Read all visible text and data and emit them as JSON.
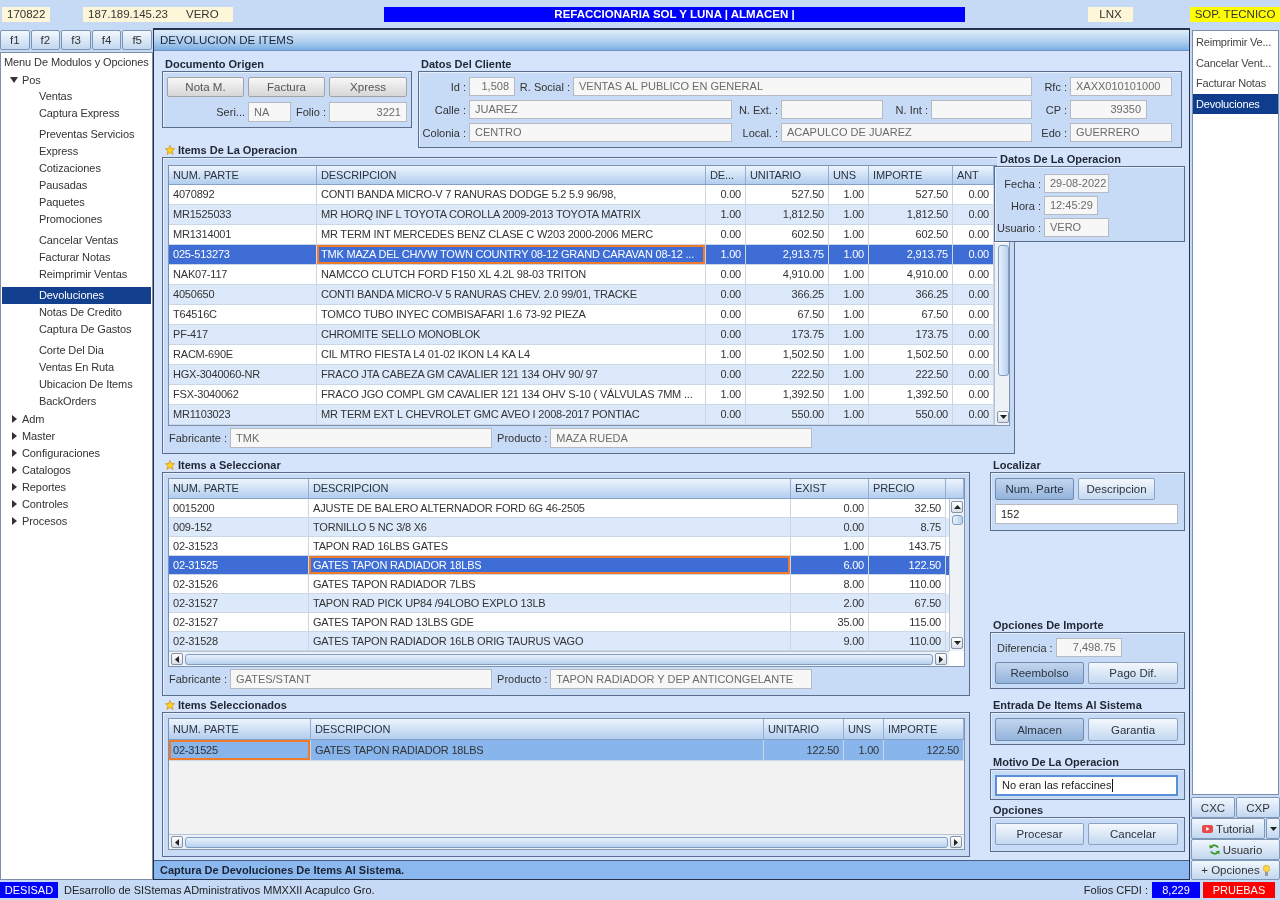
{
  "top_bar": {
    "code": "170822",
    "ip": "187.189.145.23",
    "user": "VERO",
    "title": "REFACCIONARIA SOL Y LUNA | ALMACEN |",
    "system": "LNX",
    "support": "SOP. TECNICO"
  },
  "function_keys": [
    "f1",
    "f2",
    "f3",
    "f4",
    "f5"
  ],
  "menu": {
    "title": "Menu De Modulos y Opciones",
    "items": [
      {
        "label": "Pos",
        "expanded": true,
        "groups": [
          {
            "children": [
              {
                "label": "Ventas",
                "selected": false
              },
              {
                "label": "Captura Express",
                "selected": false
              }
            ]
          },
          {
            "children": [
              {
                "label": "Preventas Servicios",
                "selected": false
              },
              {
                "label": "Express",
                "selected": false
              },
              {
                "label": "Cotizaciones",
                "selected": false
              },
              {
                "label": "Pausadas",
                "selected": false
              },
              {
                "label": "Paquetes",
                "selected": false
              },
              {
                "label": "Promociones",
                "selected": false
              }
            ]
          },
          {
            "children": [
              {
                "label": "Cancelar Ventas",
                "selected": false
              },
              {
                "label": "Facturar Notas",
                "selected": false
              },
              {
                "label": "Reimprimir Ventas",
                "selected": false
              }
            ]
          },
          {
            "children": [
              {
                "label": "Devoluciones",
                "selected": true
              },
              {
                "label": "Notas De Credito",
                "selected": false
              },
              {
                "label": "Captura De Gastos",
                "selected": false
              }
            ]
          },
          {
            "children": [
              {
                "label": "Corte Del Dia",
                "selected": false
              },
              {
                "label": "Ventas En Ruta",
                "selected": false
              },
              {
                "label": "Ubicacion De Items",
                "selected": false
              },
              {
                "label": "BackOrders",
                "selected": false
              }
            ]
          }
        ]
      },
      {
        "label": "Adm",
        "expanded": false
      },
      {
        "label": "Master",
        "expanded": false
      },
      {
        "label": "Configuraciones",
        "expanded": false
      },
      {
        "label": "Catalogos",
        "expanded": false
      },
      {
        "label": "Reportes",
        "expanded": false
      },
      {
        "label": "Controles",
        "expanded": false
      },
      {
        "label": "Procesos",
        "expanded": false
      }
    ]
  },
  "window": {
    "title": "DEVOLUCION DE ITEMS",
    "status": "Captura De Devoluciones De Items Al Sistema."
  },
  "documento_origen": {
    "title": "Documento Origen",
    "buttons": [
      "Nota M.",
      "Factura",
      "Xpress"
    ],
    "fields": [
      {
        "label": "Seri...",
        "value": "NA",
        "kind": "text"
      },
      {
        "label": "Folio :",
        "value": "3221",
        "kind": "number"
      }
    ]
  },
  "datos_cliente": {
    "title": "Datos Del Cliente",
    "rows": [
      [
        {
          "label": "Id :",
          "value": "1,508",
          "kind": "number"
        },
        {
          "label": "R. Social :",
          "value": "VENTAS AL PUBLICO EN GENERAL",
          "kind": "text"
        },
        {
          "label": "Rfc :",
          "value": "XAXX010101000",
          "kind": "text"
        }
      ],
      [
        {
          "label": "Calle :",
          "value": "JUAREZ",
          "kind": "text"
        },
        {
          "label": "N. Ext. :"
        },
        {
          "label": "N. Int :"
        },
        {
          "label": "CP :",
          "value": "39350",
          "kind": "number"
        }
      ],
      [
        {
          "label": "Colonia :",
          "value": "CENTRO",
          "kind": "text"
        },
        {
          "label": "Local. :",
          "value": "ACAPULCO DE JUAREZ",
          "kind": "text"
        },
        {
          "label": "Edo :",
          "value": "GUERRERO",
          "kind": "text"
        }
      ]
    ]
  },
  "items_operacion": {
    "title": "Items De La Operacion",
    "active": true,
    "columns": [
      {
        "label": "NUM. PARTE",
        "kind": "text",
        "focused": false
      },
      {
        "label": "DESCRIPCION",
        "kind": "text",
        "focused": true
      },
      {
        "label": "DE...",
        "kind": "number",
        "focused": false
      },
      {
        "label": "UNITARIO",
        "kind": "number",
        "focused": false
      },
      {
        "label": "UNS",
        "kind": "number",
        "focused": false
      },
      {
        "label": "IMPORTE",
        "kind": "number",
        "focused": false
      },
      {
        "label": "ANT",
        "kind": "number",
        "focused": false
      }
    ],
    "rows": [
      {
        "cells": [
          "4070892",
          "CONTI BANDA MICRO-V 7 RANURAS DODGE 5.2 5.9 96/98,",
          "0.00",
          "527.50",
          "1.00",
          "527.50",
          "0.00"
        ],
        "selected": false
      },
      {
        "cells": [
          "MR1525033",
          "MR HORQ INF L TOYOTA COROLLA 2009-2013 TOYOTA MATRIX",
          "1.00",
          "1,812.50",
          "1.00",
          "1,812.50",
          "0.00"
        ],
        "selected": false
      },
      {
        "cells": [
          "MR1314001",
          "MR TERM INT MERCEDES BENZ CLASE C W203 2000-2006 MERC",
          "0.00",
          "602.50",
          "1.00",
          "602.50",
          "0.00"
        ],
        "selected": false
      },
      {
        "cells": [
          "025-513273",
          "TMK MAZA DEL CH/VW TOWN COUNTRY 08-12 GRAND CARAVAN 08-12 ...",
          "1.00",
          "2,913.75",
          "1.00",
          "2,913.75",
          "0.00"
        ],
        "selected": true
      },
      {
        "cells": [
          "NAK07-117",
          "NAMCCO CLUTCH FORD F150 XL 4.2L 98-03 TRITON",
          "0.00",
          "4,910.00",
          "1.00",
          "4,910.00",
          "0.00"
        ],
        "selected": false
      },
      {
        "cells": [
          "4050650",
          "CONTI BANDA MICRO-V 5 RANURAS CHEV. 2.0 99/01, TRACKE",
          "0.00",
          "366.25",
          "1.00",
          "366.25",
          "0.00"
        ],
        "selected": false
      },
      {
        "cells": [
          "T64516C",
          "TOMCO TUBO INYEC COMBISAFARI 1.6 73-92 PIEZA",
          "0.00",
          "67.50",
          "1.00",
          "67.50",
          "0.00"
        ],
        "selected": false
      },
      {
        "cells": [
          "PF-417",
          "CHROMITE SELLO MONOBLOK",
          "0.00",
          "173.75",
          "1.00",
          "173.75",
          "0.00"
        ],
        "selected": false
      },
      {
        "cells": [
          "RACM-690E",
          "CIL MTRO FIESTA L4 01-02 IKON L4 KA L4",
          "1.00",
          "1,502.50",
          "1.00",
          "1,502.50",
          "0.00"
        ],
        "selected": false
      },
      {
        "cells": [
          "HGX-3040060-NR",
          "FRACO JTA CABEZA GM CAVALIER 121 134 OHV 90/ 97",
          "0.00",
          "222.50",
          "1.00",
          "222.50",
          "0.00"
        ],
        "selected": false
      },
      {
        "cells": [
          "FSX-3040062",
          "FRACO JGO COMPL GM CAVALIER 121 134 OHV S-10 ( VÁLVULAS 7MM ...",
          "1.00",
          "1,392.50",
          "1.00",
          "1,392.50",
          "0.00"
        ],
        "selected": false
      },
      {
        "cells": [
          "MR1103023",
          "MR TERM EXT L CHEVROLET GMC AVEO I 2008-2017 PONTIAC",
          "0.00",
          "550.00",
          "1.00",
          "550.00",
          "0.00"
        ],
        "selected": false
      }
    ],
    "details": [
      {
        "label": "Fabricante :",
        "value": "TMK"
      },
      {
        "label": "Producto :",
        "value": "MAZA RUEDA"
      }
    ]
  },
  "datos_operacion": {
    "title": "Datos De La Operacion",
    "fields": [
      {
        "label": "Fecha :",
        "value": "29-08-2022"
      },
      {
        "label": "Hora :",
        "value": "12:45:29"
      },
      {
        "label": "Usuario :",
        "value": "VERO"
      }
    ]
  },
  "items_seleccionar": {
    "title": "Items a Seleccionar",
    "active": true,
    "columns": [
      {
        "label": "NUM. PARTE",
        "kind": "text",
        "focused": false
      },
      {
        "label": "DESCRIPCION",
        "kind": "text",
        "focused": true
      },
      {
        "label": "EXIST",
        "kind": "number",
        "focused": false
      },
      {
        "label": "PRECIO",
        "kind": "number",
        "focused": false
      }
    ],
    "rows": [
      {
        "cells": [
          "0015200",
          "AJUSTE DE BALERO ALTERNADOR FORD 6G 46-2505",
          "0.00",
          "32.50"
        ],
        "selected": false
      },
      {
        "cells": [
          "009-152",
          "TORNILLO 5 NC 3/8 X6",
          "0.00",
          "8.75"
        ],
        "selected": false
      },
      {
        "cells": [
          "02-31523",
          "TAPON RAD 16LBS GATES",
          "1.00",
          "143.75"
        ],
        "selected": false
      },
      {
        "cells": [
          "02-31525",
          "GATES TAPON RADIADOR 18LBS",
          "6.00",
          "122.50"
        ],
        "selected": true
      },
      {
        "cells": [
          "02-31526",
          "GATES TAPON RADIADOR 7LBS",
          "8.00",
          "110.00"
        ],
        "selected": false
      },
      {
        "cells": [
          "02-31527",
          "TAPON RAD PICK UP84 /94LOBO EXPLO 13LB",
          "2.00",
          "67.50"
        ],
        "selected": false
      },
      {
        "cells": [
          "02-31527",
          "GATES TAPON RAD 13LBS GDE",
          "35.00",
          "115.00"
        ],
        "selected": false
      },
      {
        "cells": [
          "02-31528",
          "GATES TAPON RADIADOR 16LB ORIG TAURUS VAGO",
          "9.00",
          "110.00"
        ],
        "selected": false
      }
    ],
    "details": [
      {
        "label": "Fabricante :",
        "value": "GATES/STANT"
      },
      {
        "label": "Producto :",
        "value": "TAPON RADIADOR Y DEP ANTICONGELANTE"
      }
    ]
  },
  "items_seleccionados": {
    "title": "Items Seleccionados",
    "active": false,
    "columns": [
      {
        "label": "NUM. PARTE",
        "kind": "text",
        "focused": true
      },
      {
        "label": "DESCRIPCION",
        "kind": "text",
        "focused": false
      },
      {
        "label": "UNITARIO",
        "kind": "number",
        "focused": false
      },
      {
        "label": "UNS",
        "kind": "number",
        "focused": false
      },
      {
        "label": "IMPORTE",
        "kind": "number",
        "focused": false
      }
    ],
    "rows": [
      {
        "cells": [
          "02-31525",
          "GATES TAPON RADIADOR 18LBS",
          "122.50",
          "1.00",
          "122.50"
        ],
        "selected": true
      }
    ]
  },
  "localizar": {
    "title": "Localizar",
    "buttons": [
      {
        "label": "Num. Parte",
        "selected": true
      },
      {
        "label": "Descripcion",
        "selected": false
      }
    ],
    "search": {
      "value": "152"
    }
  },
  "opciones_importe": {
    "title": "Opciones De Importe",
    "field": {
      "label": "Diferencia :",
      "value": "7,498.75"
    },
    "buttons": [
      {
        "label": "Reembolso",
        "selected": true
      },
      {
        "label": "Pago Dif.",
        "selected": false
      }
    ]
  },
  "entrada": {
    "title": "Entrada De Items Al Sistema",
    "buttons": [
      {
        "label": "Almacen",
        "selected": true
      },
      {
        "label": "Garantia",
        "selected": false
      }
    ]
  },
  "motivo": {
    "title": "Motivo De La Operacion",
    "value": "No eran las refaccines",
    "focused": true
  },
  "opciones": {
    "title": "Opciones",
    "buttons": [
      "Procesar",
      "Cancelar"
    ]
  },
  "side_panel": {
    "items": [
      {
        "label": "Reimprimir Ve...",
        "selected": false
      },
      {
        "label": "Cancelar Vent...",
        "selected": false
      },
      {
        "label": "Facturar Notas",
        "selected": false
      },
      {
        "label": "Devoluciones",
        "selected": true
      }
    ],
    "account_buttons": [
      "CXC",
      "CXP"
    ],
    "tutorial": "Tutorial",
    "usuario": "Usuario",
    "opciones": "+ Opciones"
  },
  "status_bar": {
    "brand": "DESISAD",
    "text": "DEsarrollo de SIStemas ADministrativos MMXXII Acapulco Gro.",
    "folios_label": "Folios CFDI :",
    "folios": "8,229",
    "mode": "PRUEBAS"
  }
}
